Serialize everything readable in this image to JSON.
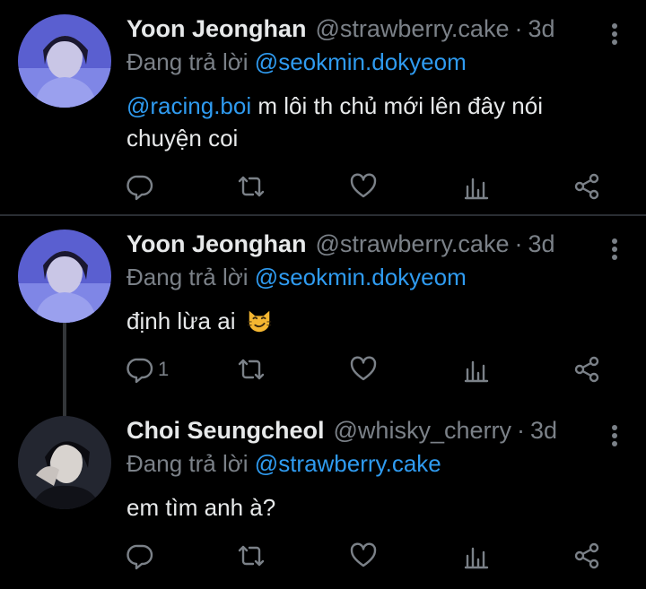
{
  "tweets": [
    {
      "name": "Yoon Jeonghan",
      "handle": "@strawberry.cake",
      "dot": "·",
      "time": "3d",
      "replying_prefix": "Đang trả lời",
      "replying_to": "@seokmin.dokyeom",
      "mention": "@racing.boi",
      "text": " m lôi th chủ mới lên đây nói chuyện coi",
      "reply_count": ""
    },
    {
      "name": "Yoon Jeonghan",
      "handle": "@strawberry.cake",
      "dot": "·",
      "time": "3d",
      "replying_prefix": "Đang trả lời",
      "replying_to": "@seokmin.dokyeom",
      "text": "định lừa ai",
      "emoji": "smirking-cat-emoji",
      "reply_count": "1"
    },
    {
      "name": "Choi Seungcheol",
      "handle": "@whisky_cherry",
      "dot": "·",
      "time": "3d",
      "replying_prefix": "Đang trả lời",
      "replying_to": "@strawberry.cake",
      "text": "em tìm anh à?",
      "reply_count": ""
    }
  ],
  "icons": [
    "reply-icon",
    "retweet-icon",
    "like-icon",
    "analytics-icon",
    "share-icon",
    "more-icon"
  ],
  "colors": {
    "background": "#000000",
    "text": "#e7e9ea",
    "muted": "#7b8188",
    "link": "#2f9bf0",
    "separator": "#2a2e33"
  }
}
